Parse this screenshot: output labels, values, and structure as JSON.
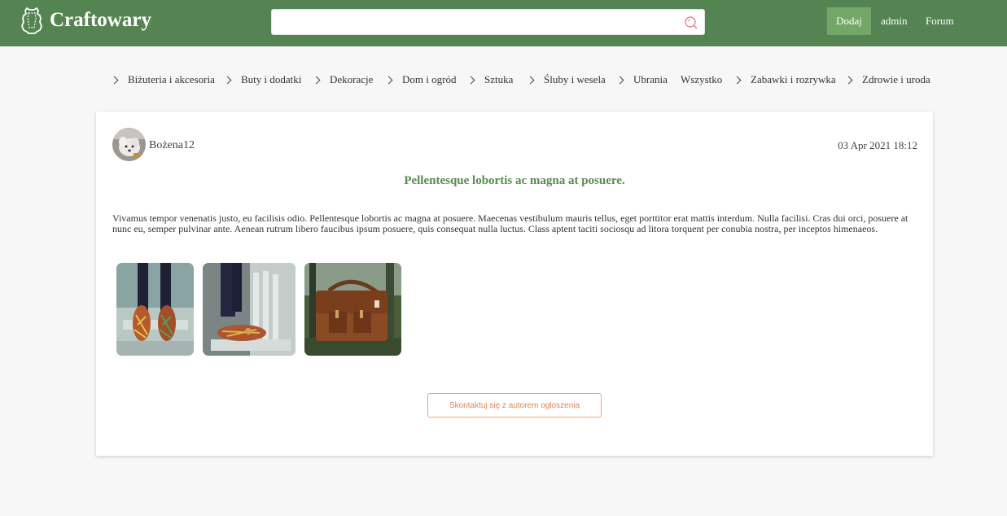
{
  "header": {
    "logo_text": "Craftowary",
    "logo_icon": "hide-leather-icon",
    "search_placeholder": "",
    "search_icon": "search-icon",
    "add_label": "Dodaj",
    "admin_label": "admin",
    "forum_label": "Forum"
  },
  "categories": [
    "Biżuteria i akcesoria",
    "Buty i dodatki",
    "Dekoracje",
    "Dom i ogród",
    "Sztuka",
    "Śluby i wesela",
    "Ubrania",
    "Wszystko",
    "Zabawki i rozrywka",
    "Zdrowie i uroda"
  ],
  "post": {
    "author": "Bożena12",
    "date": "03 Apr 2021 18:12",
    "title": "Pellentesque lobortis ac magna at posuere.",
    "body": "Vivamus tempor venenatis justo, eu facilisis odio. Pellentesque lobortis ac magna at posuere. Maecenas vestibulum mauris tellus, eget porttitor erat mattis interdum. Nulla facilisi. Cras dui orci, posuere at nunc eu, semper pulvinar ante. Aenean rutrum libero faucibus ipsum posuere, quis consequat nulla luctus. Class aptent taciti sociosqu ad litora torquent per conubia nostra, per inceptos himenaeos.",
    "images": [
      "woven-shoes-photo",
      "woven-shoes-side-photo",
      "leather-bag-photo"
    ],
    "contact_label": "Skontaktuj się z autorem ogłoszenia"
  },
  "colors": {
    "header_bg": "#548451",
    "accent_button": "#72a767",
    "title_green": "#5a8a52",
    "contact_orange": "#e2845a"
  }
}
